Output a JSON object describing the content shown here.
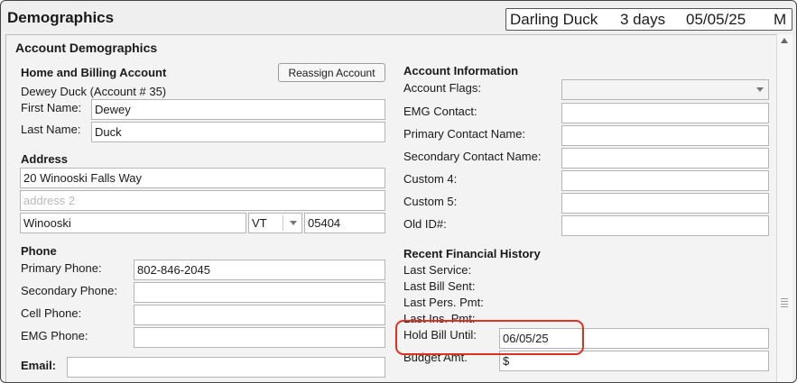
{
  "header": {
    "title": "Demographics",
    "patient_name": "Darling Duck",
    "age": "3 days",
    "dob": "05/05/25",
    "sex": "M"
  },
  "account_demographics": {
    "title": "Account Demographics",
    "home_billing": {
      "title": "Home and Billing Account",
      "reassign_label": "Reassign Account",
      "account_line": "Dewey Duck (Account # 35)",
      "first_name_label": "First Name:",
      "first_name": "Dewey",
      "last_name_label": "Last Name:",
      "last_name": "Duck"
    },
    "address": {
      "title": "Address",
      "line1": "20 Winooski Falls Way",
      "line2_placeholder": "address 2",
      "city": "Winooski",
      "state": "VT",
      "zip": "05404"
    },
    "phone": {
      "title": "Phone",
      "primary_label": "Primary Phone:",
      "primary": "802-846-2045",
      "secondary_label": "Secondary Phone:",
      "secondary": "",
      "cell_label": "Cell Phone:",
      "cell": "",
      "emg_label": "EMG Phone:",
      "emg": ""
    },
    "email": {
      "label": "Email:",
      "value": ""
    }
  },
  "account_information": {
    "title": "Account Information",
    "flags_label": "Account Flags:",
    "flags_value": "",
    "emg_contact_label": "EMG Contact:",
    "primary_contact_label": "Primary Contact Name:",
    "secondary_contact_label": "Secondary Contact Name:",
    "custom4_label": "Custom 4:",
    "custom5_label": "Custom 5:",
    "old_id_label": "Old ID#:"
  },
  "financial_history": {
    "title": "Recent Financial History",
    "last_service_label": "Last Service:",
    "last_bill_label": "Last Bill Sent:",
    "last_pers_label": "Last Pers. Pmt:",
    "last_ins_label": "Last Ins. Pmt:",
    "hold_bill_label": "Hold Bill Until:",
    "hold_bill_value": "06/05/25",
    "budget_label": "Budget Amt.",
    "budget_value": "$"
  },
  "colors": {
    "highlight": "#e0301e",
    "background": "#efefef"
  }
}
